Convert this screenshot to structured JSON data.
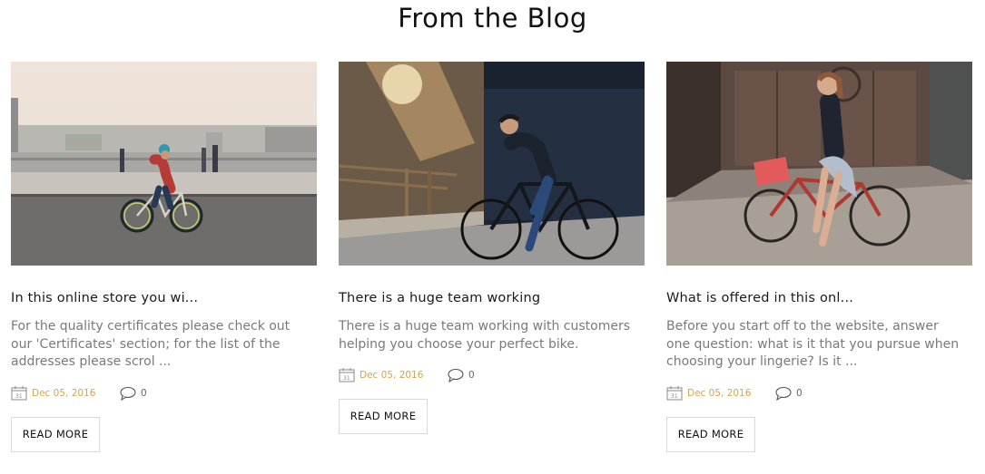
{
  "section": {
    "title": "From the Blog"
  },
  "posts": [
    {
      "title": "In this online store you wi...",
      "excerpt": "For the quality certificates please check out our 'Certificates' section; for the list of the addresses please scrol ...",
      "date": "Dec 05, 2016",
      "comments": "0",
      "read_more": "READ MORE",
      "image_alt": "cyclist riding on a city street"
    },
    {
      "title": "There is a huge team working",
      "excerpt": "There is a huge team working with customers helping you choose your perfect bike.",
      "date": "Dec 05, 2016",
      "comments": "0",
      "read_more": "READ MORE",
      "image_alt": "man sitting on a bicycle by a wall"
    },
    {
      "title": "What is offered in this onl...",
      "excerpt": "Before you start off to the website, answer one question: what is it that you pursue when choosing your lingerie? Is it ...",
      "date": "Dec 05, 2016",
      "comments": "0",
      "read_more": "READ MORE",
      "image_alt": "woman with a red bicycle"
    }
  ],
  "icons": {
    "date": "calendar-icon",
    "comments": "comment-bubble-icon"
  },
  "colors": {
    "date": "#d4a552",
    "excerpt": "#7a7a7a",
    "button_border": "#d9d9d9"
  }
}
